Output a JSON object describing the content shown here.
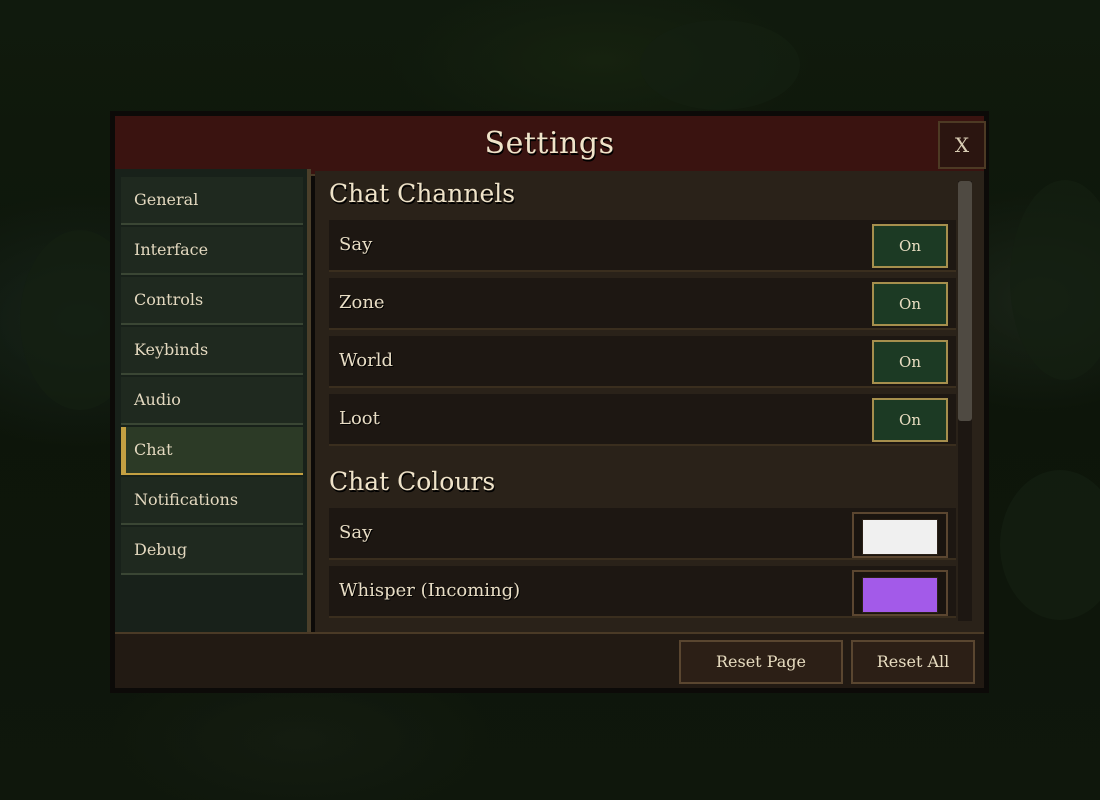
{
  "dialog": {
    "title": "Settings",
    "close_label": "X"
  },
  "sidebar": {
    "items": [
      {
        "label": "General",
        "active": false
      },
      {
        "label": "Interface",
        "active": false
      },
      {
        "label": "Controls",
        "active": false
      },
      {
        "label": "Keybinds",
        "active": false
      },
      {
        "label": "Audio",
        "active": false
      },
      {
        "label": "Chat",
        "active": true
      },
      {
        "label": "Notifications",
        "active": false
      },
      {
        "label": "Debug",
        "active": false
      }
    ]
  },
  "content": {
    "chat_channels": {
      "title": "Chat Channels",
      "rows": [
        {
          "label": "Say",
          "value": "On"
        },
        {
          "label": "Zone",
          "value": "On"
        },
        {
          "label": "World",
          "value": "On"
        },
        {
          "label": "Loot",
          "value": "On"
        }
      ]
    },
    "chat_colours": {
      "title": "Chat Colours",
      "rows": [
        {
          "label": "Say",
          "color": "#f0f0f0"
        },
        {
          "label": "Whisper (Incoming)",
          "color": "#a35ae9"
        }
      ]
    }
  },
  "footer": {
    "reset_page_label": "Reset Page",
    "reset_all_label": "Reset All"
  },
  "colors": {
    "title_bar": "#3a1310",
    "sidebar_bg": "#18211a",
    "content_bg": "#2a2219",
    "active_accent": "#c4a042",
    "toggle_on_bg": "#1c3a24"
  }
}
